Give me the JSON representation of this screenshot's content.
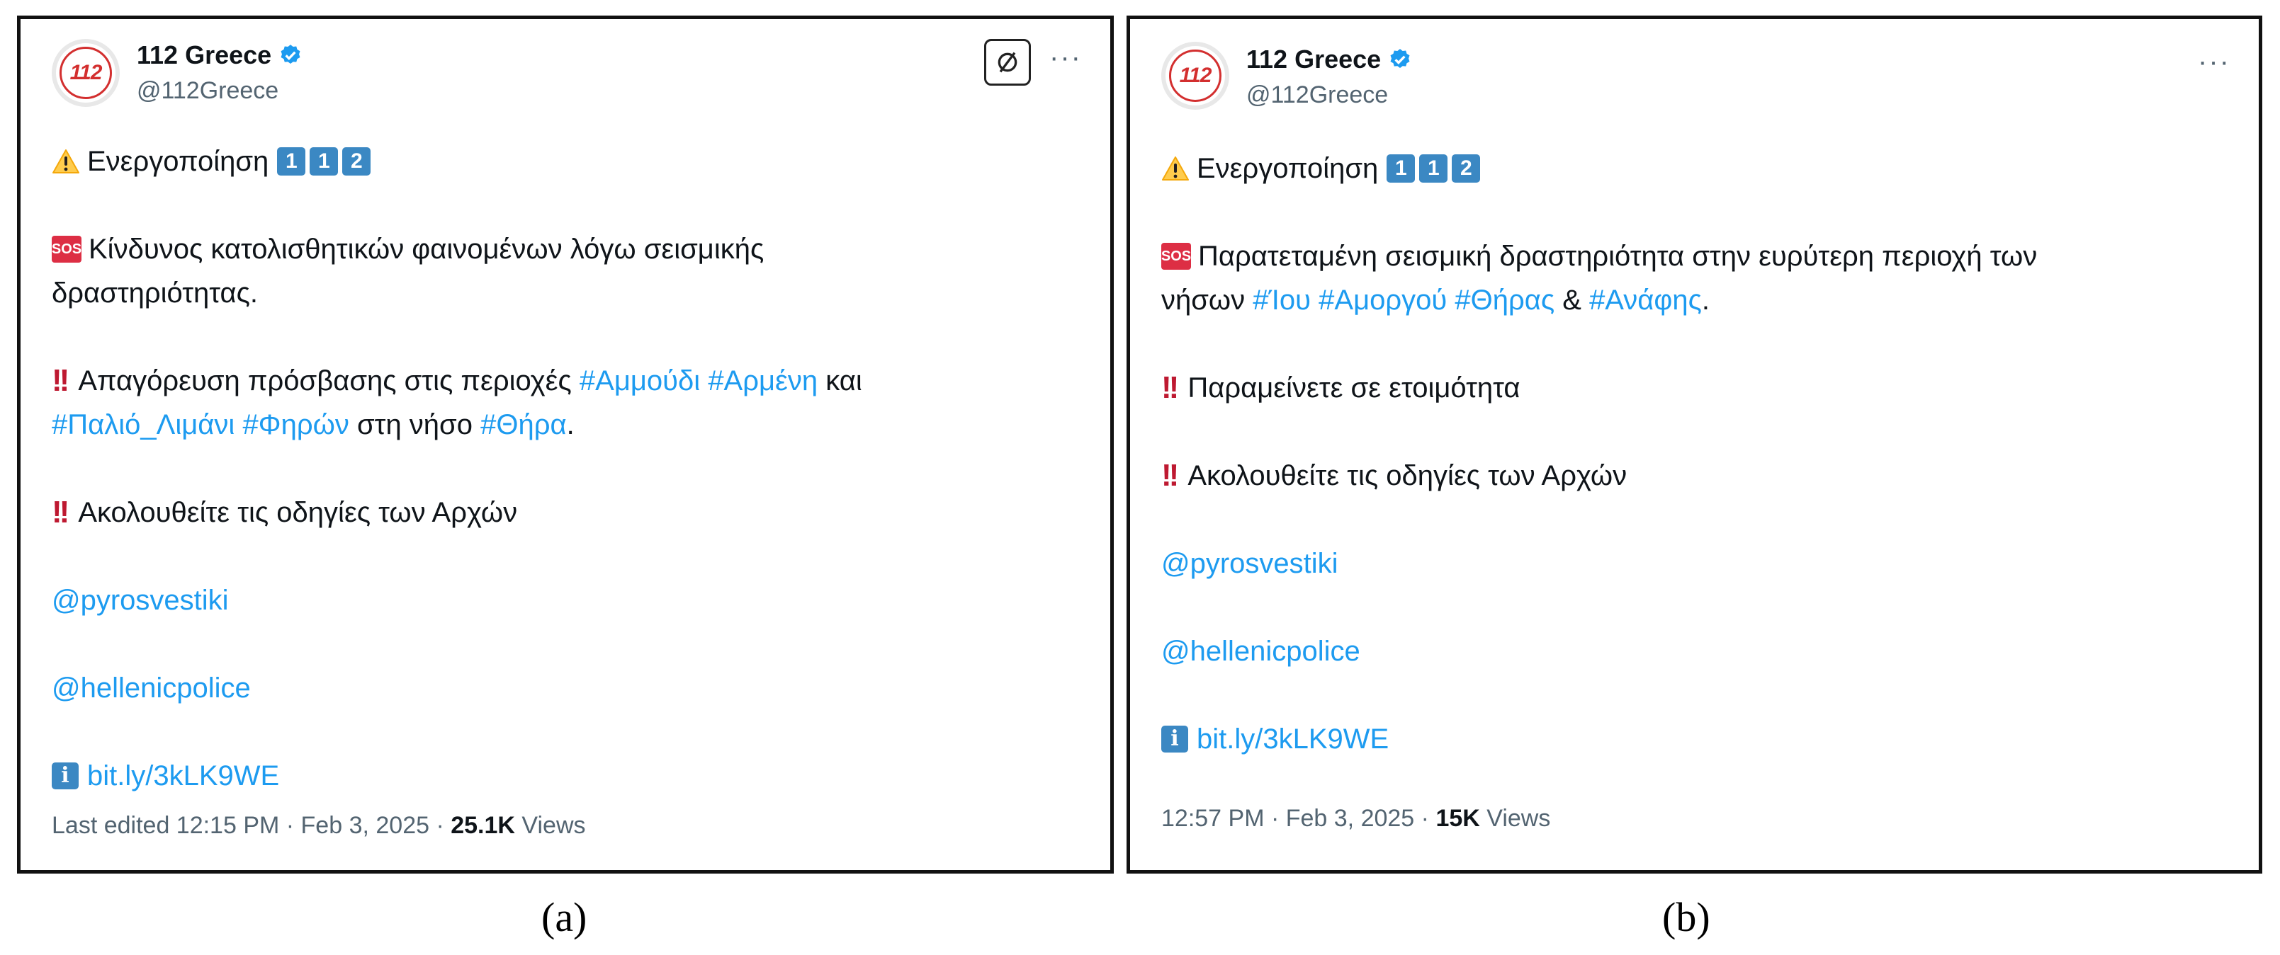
{
  "panel_a": {
    "author_name": "112 Greece",
    "handle": "@112Greece",
    "avatar_text": "112",
    "activation": "Ενεργοποίηση",
    "keycaps": [
      "1",
      "1",
      "2"
    ],
    "sos_label": "SOS",
    "sos_line1": "Κίνδυνος κατολισθητικών φαινομένων λόγω σεισμικής",
    "sos_line2": "δραστηριότητας.",
    "ban_text": "Απαγόρευση πρόσβασης στις περιοχές",
    "tag_ammoudi": "#Αμμούδι",
    "tag_armeni": "#Αρμένη",
    "and_word": "και",
    "tag_palio": "#Παλιό_Λιμάνι",
    "tag_firon": "#Φηρών",
    "island_text": "στη νήσο",
    "tag_thira": "#Θήρα",
    "period": ".",
    "follow_text": "Ακολουθείτε τις οδηγίες των Αρχών",
    "mention_1": "@pyrosvestiki",
    "mention_2": "@hellenicpolice",
    "info_label": "i",
    "short_link": "bit.ly/3kLK9WE",
    "timestamp": "Last edited 12:15 PM · Feb 3, 2025 ·",
    "views_count": "25.1K",
    "views_label": "Views",
    "more_icon": "···"
  },
  "panel_b": {
    "author_name": "112 Greece",
    "handle": "@112Greece",
    "avatar_text": "112",
    "activation": "Ενεργοποίηση",
    "keycaps": [
      "1",
      "1",
      "2"
    ],
    "sos_label": "SOS",
    "sos_line1": "Παρατεταμένη σεισμική δραστηριότητα στην ευρύτερη περιοχή των",
    "islands_prefix": "νήσων",
    "tag_ios": "#Ίου",
    "tag_amorgos": "#Αμοργού",
    "tag_thiras": "#Θήρας",
    "amp": "&",
    "tag_anafi": "#Ανάφης",
    "period": ".",
    "standby_text": "Παραμείνετε σε ετοιμότητα",
    "follow_text": "Ακολουθείτε τις οδηγίες των Αρχών",
    "mention_1": "@pyrosvestiki",
    "mention_2": "@hellenicpolice",
    "info_label": "i",
    "short_link": "bit.ly/3kLK9WE",
    "timestamp": "12:57 PM · Feb 3, 2025 ·",
    "views_count": "15K",
    "views_label": "Views",
    "more_icon": "···"
  },
  "captions": {
    "a": "(a)",
    "b": "(b)"
  },
  "colors": {
    "link": "#1d9bf0",
    "verified": "#1d9bf0",
    "keycap": "#3b88c3",
    "sos": "#dd2e44",
    "bang": "#be1931",
    "avatar_red": "#d32f2f"
  }
}
